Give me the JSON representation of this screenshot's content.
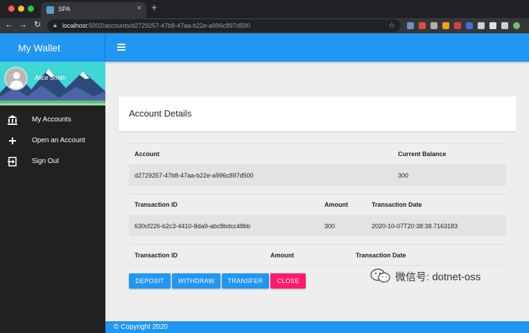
{
  "browser": {
    "tab_title": "SPA",
    "tab_close": "×",
    "new_tab": "+",
    "url_host": "localhost",
    "url_path": ":5002/accounts/d2729257-47b8-47aa-b22e-a996c897d500",
    "extension_colors": [
      "#6f8fbf",
      "#e04b3a",
      "#b0b0b0",
      "#f0a020",
      "#d04040",
      "#3b6fd4",
      "#cfcfcf",
      "#e0e0e0",
      "#d0d0d0",
      "#6ac46a"
    ]
  },
  "app": {
    "brand": "My Wallet",
    "user_name": "Alice Smith",
    "menu": [
      {
        "label": "My Accounts",
        "icon": "bank-icon"
      },
      {
        "label": "Open an Account",
        "icon": "plus-icon"
      },
      {
        "label": "Sign Out",
        "icon": "sign-out-icon"
      }
    ],
    "colors": {
      "primary": "#2196f3",
      "sidebar": "#212121",
      "danger": "#ff1a6b"
    }
  },
  "main": {
    "card_title": "Account Details",
    "account_table": {
      "headers": [
        "Account",
        "Current Balance"
      ],
      "rows": [
        [
          "d2729257-47b8-47aa-b22e-a996c897d500",
          "300"
        ]
      ]
    },
    "transactions_table": {
      "headers": [
        "Transaction ID",
        "Amount",
        "Transaction Date"
      ],
      "rows": [
        [
          "630cf226-b2c3-4410-8da9-abc8bdcc48bb",
          "300",
          "2020-10-07T20:38:38.7163183"
        ]
      ]
    },
    "empty_table": {
      "headers": [
        "Transaction ID",
        "Amount",
        "Transaction Date"
      ]
    },
    "buttons": {
      "deposit": "DEPOSIT",
      "withdraw": "WITHDRAW",
      "transfer": "TRANSFER",
      "close": "CLOSE"
    }
  },
  "footer": {
    "copyright": "© Copyright 2020"
  },
  "watermark": {
    "text": "微信号: dotnet-oss"
  }
}
